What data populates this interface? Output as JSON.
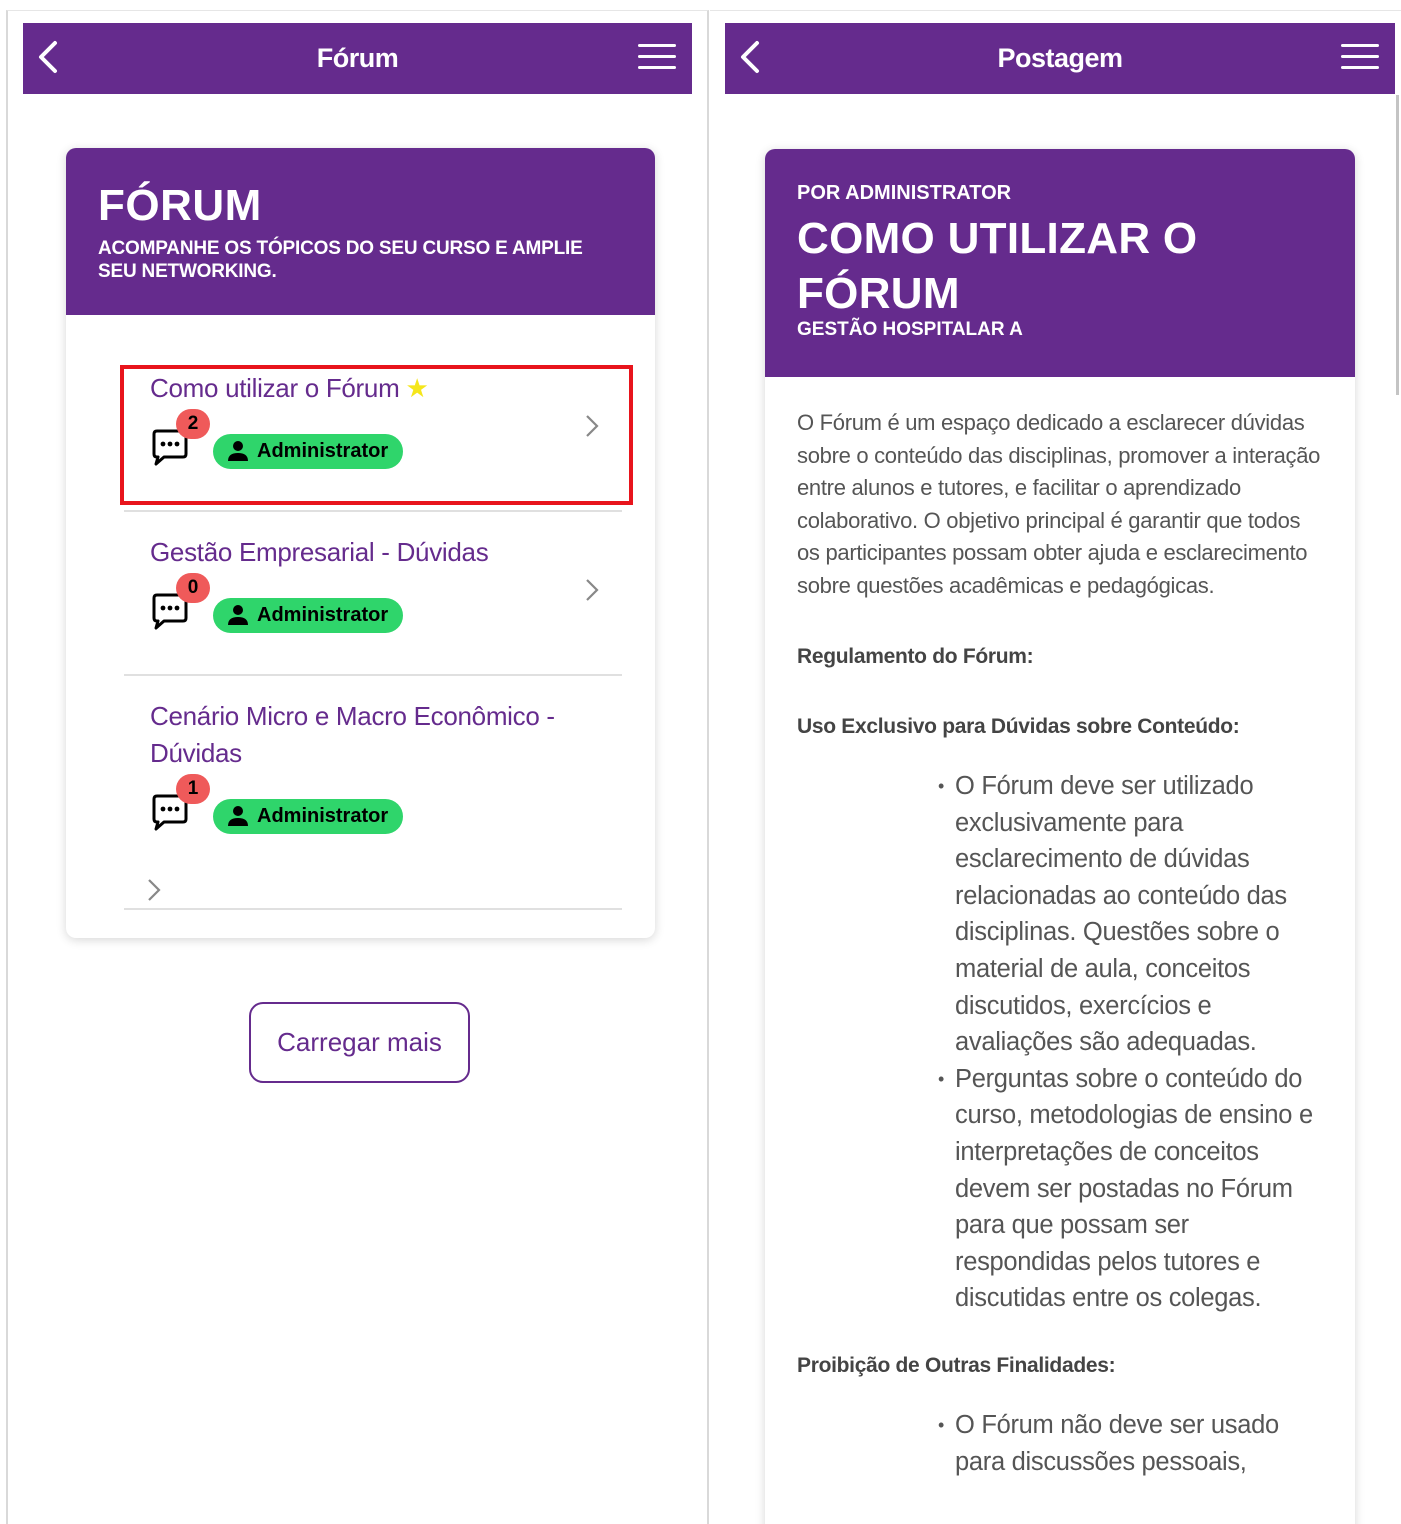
{
  "left_screen": {
    "appbar": {
      "title": "Fórum"
    },
    "card": {
      "title": "FÓRUM",
      "subtitle": "ACOMPANHE OS TÓPICOS DO SEU CURSO E AMPLIE SEU NETWORKING."
    },
    "topics": [
      {
        "title": "Como utilizar o Fórum",
        "starred": true,
        "comments": "2",
        "author": "Administrator",
        "highlighted": true
      },
      {
        "title": "Gestão Empresarial - Dúvidas",
        "starred": false,
        "comments": "0",
        "author": "Administrator",
        "highlighted": false
      },
      {
        "title_line1": "Cenário Micro e Macro Econômico -",
        "title_line2": "Dúvidas",
        "starred": false,
        "comments": "1",
        "author": "Administrator",
        "highlighted": false
      }
    ],
    "load_more": "Carregar mais"
  },
  "right_screen": {
    "appbar": {
      "title": "Postagem"
    },
    "post": {
      "by": "POR ADMINISTRATOR",
      "title_line1": "COMO UTILIZAR O",
      "title_line2": "FÓRUM",
      "course": "GESTÃO HOSPITALAR A",
      "intro": "O Fórum é um espaço dedicado a esclarecer dúvidas sobre o conteúdo das disciplinas, promover a interação entre alunos e tutores, e facilitar o aprendizado colaborativo. O objetivo principal é garantir que todos os participantes possam obter ajuda e esclarecimento sobre questões acadêmicas e pedagógicas.",
      "regulation_heading": "Regulamento do Fórum:",
      "section1_heading": "Uso Exclusivo para Dúvidas sobre Conteúdo:",
      "section1_items": [
        "O Fórum deve ser utilizado exclusivamente para esclarecimento de dúvidas relacionadas ao conteúdo das disciplinas. Questões sobre o material de aula, conceitos discutidos, exercícios e avaliações são adequadas.",
        "Perguntas sobre o conteúdo do curso, metodologias de ensino e interpretações de conceitos devem ser postadas no Fórum para que possam ser respondidas pelos tutores e discutidas entre os colegas."
      ],
      "section2_heading": "Proibição de Outras Finalidades:",
      "section2_items": [
        "O Fórum não deve ser usado para discussões pessoais,"
      ]
    }
  },
  "colors": {
    "brand_purple": "#652b8d",
    "chip_green": "#2fd56b",
    "badge_red": "#ef5a5a",
    "star_yellow": "#f5e61b",
    "highlight_red": "#e8141c"
  },
  "icons": [
    "back-chevron-icon",
    "hamburger-menu-icon",
    "comment-bubble-icon",
    "user-icon",
    "chevron-right-icon",
    "star-icon"
  ]
}
